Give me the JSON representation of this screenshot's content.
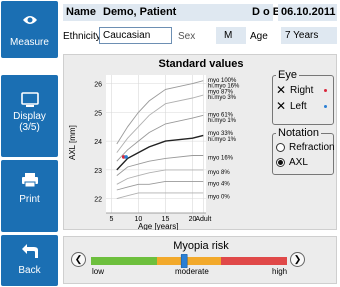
{
  "sidebar": {
    "measure_label": "Measure",
    "display_label": "Display\n(3/5)",
    "display_line1": "Display",
    "display_line2": "(3/5)",
    "print_label": "Print",
    "back_label": "Back"
  },
  "header": {
    "name_key": "Name",
    "name_value": "Demo, Patient",
    "dob_key": "D o B",
    "dob_value": "06.10.2011",
    "ethnicity_key": "Ethnicity",
    "ethnicity_value": "Caucasian",
    "sex_key": "Sex",
    "sex_value": "M",
    "age_key": "Age",
    "age_value": "7 Years"
  },
  "chart_panel": {
    "title": "Standard values",
    "ylabel": "AXL [mm]",
    "xlabel": "Age [years]",
    "y_ticks": [
      "26",
      "25",
      "24",
      "23",
      "22"
    ],
    "x_ticks": [
      "5",
      "10",
      "15",
      "20",
      "Adult"
    ],
    "curve_labels": [
      "myo 100%",
      "hi.myo 16%",
      "myo 87%",
      "hi.myo 3%",
      "myo 61%",
      "hi.myo 1%",
      "myo 33%",
      "hi.myo 1%",
      "myo 16%",
      "myo 8%",
      "myo 4%",
      "myo 0%"
    ]
  },
  "eye": {
    "title": "Eye",
    "right_label": "Right",
    "left_label": "Left",
    "right_color": "#d9273a",
    "left_color": "#2a7fd4"
  },
  "notation": {
    "title": "Notation",
    "options": [
      "Refraction",
      "AXL"
    ],
    "selected": "AXL"
  },
  "risk": {
    "title": "Myopia risk",
    "low_label": "low",
    "moderate_label": "moderate",
    "high_label": "high",
    "level": 0.45
  },
  "chart_data": {
    "type": "line",
    "xlabel": "Age [years]",
    "ylabel": "AXL [mm]",
    "x_ticks": [
      "5",
      "10",
      "15",
      "20",
      "Adult"
    ],
    "ylim": [
      21.5,
      26.3
    ],
    "y_ticks": [
      22,
      23,
      24,
      25,
      26
    ],
    "x": [
      6,
      8,
      10,
      12,
      15,
      20,
      22
    ],
    "series": [
      {
        "name": "myo 100% / hi.myo 16%",
        "values": [
          23.9,
          24.5,
          25.0,
          25.4,
          25.8,
          26.0,
          26.1
        ]
      },
      {
        "name": "myo 87% / hi.myo 3%",
        "values": [
          23.6,
          24.1,
          24.5,
          24.9,
          25.3,
          25.5,
          25.6
        ]
      },
      {
        "name": "myo 61% / hi.myo 1%",
        "values": [
          23.3,
          23.7,
          24.0,
          24.3,
          24.6,
          24.8,
          24.9
        ]
      },
      {
        "name": "myo 33% / hi.myo 1%",
        "values": [
          23.0,
          23.4,
          23.6,
          23.8,
          24.0,
          24.1,
          24.2
        ]
      },
      {
        "name": "myo 16%",
        "values": [
          22.8,
          23.1,
          23.2,
          23.3,
          23.4,
          23.5,
          23.5
        ]
      },
      {
        "name": "myo 8%",
        "values": [
          22.5,
          22.7,
          22.8,
          22.9,
          23.0,
          23.0,
          23.0
        ]
      },
      {
        "name": "myo 4%",
        "values": [
          22.3,
          22.4,
          22.5,
          22.5,
          22.6,
          22.6,
          22.6
        ]
      },
      {
        "name": "myo 0%",
        "values": [
          22.0,
          22.1,
          22.2,
          22.2,
          22.2,
          22.2,
          22.2
        ]
      }
    ],
    "measurements": [
      {
        "eye": "Right",
        "age": 7.5,
        "axl": 23.45
      },
      {
        "eye": "Left",
        "age": 7.5,
        "axl": 23.45
      }
    ]
  }
}
